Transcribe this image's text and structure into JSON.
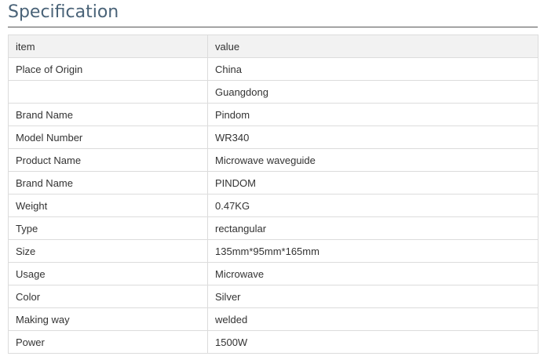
{
  "section": {
    "title": "Specification"
  },
  "table": {
    "headers": [
      "item",
      "value"
    ],
    "rows": [
      [
        "Place of Origin",
        "China"
      ],
      [
        "",
        "Guangdong"
      ],
      [
        "Brand Name",
        "Pindom"
      ],
      [
        "Model Number",
        "WR340"
      ],
      [
        "Product Name",
        "Microwave waveguide"
      ],
      [
        "Brand Name",
        "PINDOM"
      ],
      [
        "Weight",
        "0.47KG"
      ],
      [
        "Type",
        "rectangular"
      ],
      [
        "Size",
        "135mm*95mm*165mm"
      ],
      [
        "Usage",
        "Microwave"
      ],
      [
        "Color",
        "Silver"
      ],
      [
        "Making way",
        "welded"
      ],
      [
        "Power",
        "1500W"
      ]
    ]
  }
}
